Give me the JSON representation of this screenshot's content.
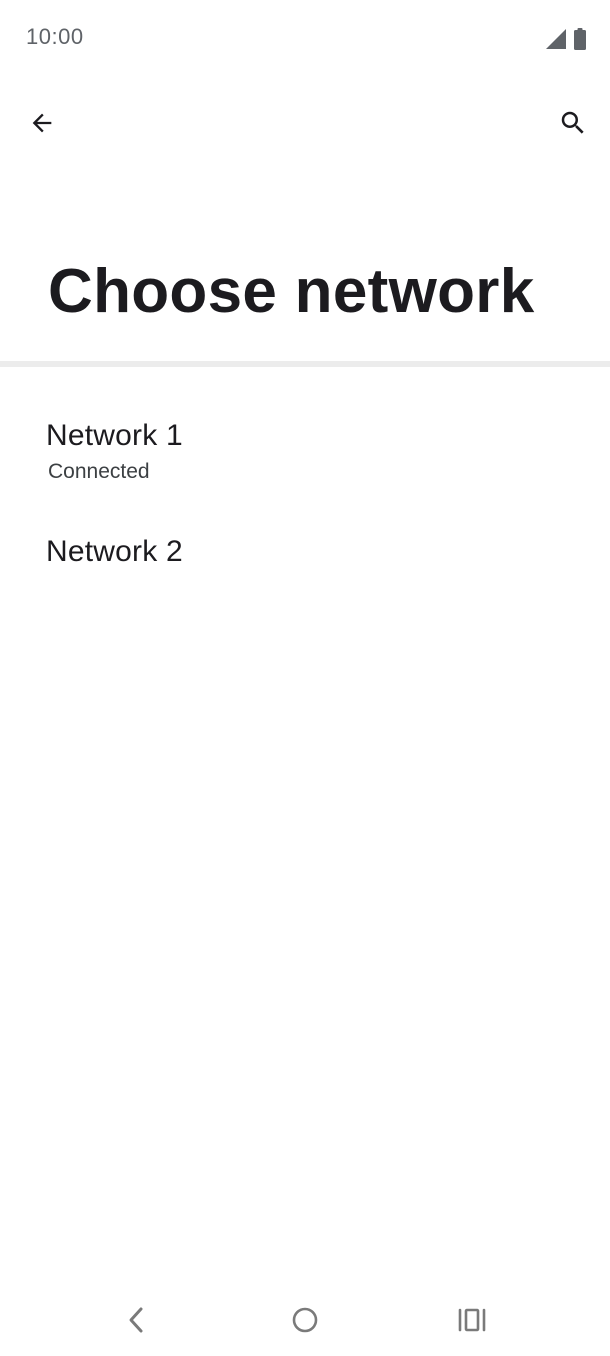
{
  "status_bar": {
    "time": "10:00",
    "icons": [
      "signal-icon",
      "battery-icon"
    ]
  },
  "app_bar": {
    "back_icon": "arrow-back-icon",
    "search_icon": "search-icon"
  },
  "page": {
    "title": "Choose network"
  },
  "networks": [
    {
      "name": "Network 1",
      "status": "Connected"
    },
    {
      "name": "Network 2",
      "status": ""
    }
  ],
  "nav_bar": {
    "icons": [
      "nav-back-icon",
      "nav-home-icon",
      "nav-recents-icon"
    ]
  },
  "colors": {
    "background": "#ffffff",
    "text_primary": "#1c1b1f",
    "text_secondary": "#3c4043",
    "divider": "#ececec",
    "nav_icon": "#7a7a7a"
  }
}
